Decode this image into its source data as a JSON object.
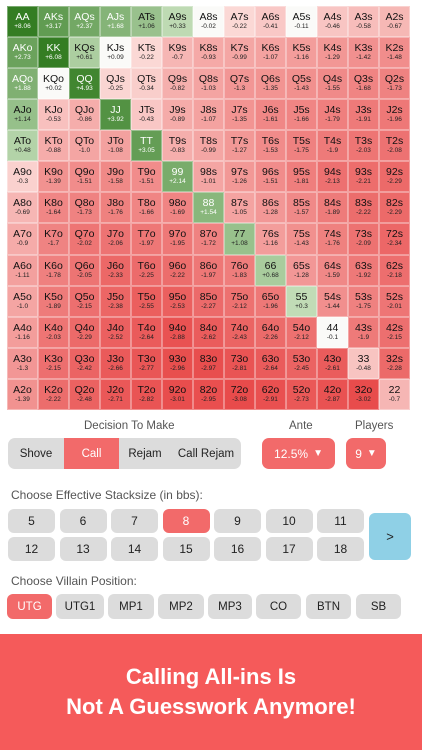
{
  "hand_grid": {
    "rows": [
      [
        [
          "AA",
          "+8.06"
        ],
        [
          "AKs",
          "+3.17"
        ],
        [
          "AQs",
          "+2.37"
        ],
        [
          "AJs",
          "+1.68"
        ],
        [
          "ATs",
          "+1.06"
        ],
        [
          "A9s",
          "+0.33"
        ],
        [
          "A8s",
          "-0.02"
        ],
        [
          "A7s",
          "-0.22"
        ],
        [
          "A6s",
          "-0.41"
        ],
        [
          "A5s",
          "-0.11"
        ],
        [
          "A4s",
          "-0.46"
        ],
        [
          "A3s",
          "-0.58"
        ],
        [
          "A2s",
          "-0.67"
        ]
      ],
      [
        [
          "AKo",
          "+2.73"
        ],
        [
          "KK",
          "+6.08"
        ],
        [
          "KQs",
          "+0.61"
        ],
        [
          "KJs",
          "+0.09"
        ],
        [
          "KTs",
          "-0.22"
        ],
        [
          "K9s",
          "-0.7"
        ],
        [
          "K8s",
          "-0.93"
        ],
        [
          "K7s",
          "-0.99"
        ],
        [
          "K6s",
          "-1.07"
        ],
        [
          "K5s",
          "-1.16"
        ],
        [
          "K4s",
          "-1.29"
        ],
        [
          "K3s",
          "-1.42"
        ],
        [
          "K2s",
          "-1.48"
        ]
      ],
      [
        [
          "AQo",
          "+1.88"
        ],
        [
          "KQo",
          "+0.02"
        ],
        [
          "QQ",
          "+4.93"
        ],
        [
          "QJs",
          "-0.25"
        ],
        [
          "QTs",
          "-0.34"
        ],
        [
          "Q9s",
          "-0.82"
        ],
        [
          "Q8s",
          "-1.03"
        ],
        [
          "Q7s",
          "-1.3"
        ],
        [
          "Q6s",
          "-1.35"
        ],
        [
          "Q5s",
          "-1.43"
        ],
        [
          "Q4s",
          "-1.55"
        ],
        [
          "Q3s",
          "-1.68"
        ],
        [
          "Q2s",
          "-1.73"
        ]
      ],
      [
        [
          "AJo",
          "+1.14"
        ],
        [
          "KJo",
          "-0.53"
        ],
        [
          "QJo",
          "-0.86"
        ],
        [
          "JJ",
          "+3.92"
        ],
        [
          "JTs",
          "-0.43"
        ],
        [
          "J9s",
          "-0.89"
        ],
        [
          "J8s",
          "-1.07"
        ],
        [
          "J7s",
          "-1.35"
        ],
        [
          "J6s",
          "-1.61"
        ],
        [
          "J5s",
          "-1.66"
        ],
        [
          "J4s",
          "-1.79"
        ],
        [
          "J3s",
          "-1.91"
        ],
        [
          "J2s",
          "-1.96"
        ]
      ],
      [
        [
          "ATo",
          "+0.48"
        ],
        [
          "KTo",
          "-0.88"
        ],
        [
          "QTo",
          "-1.0"
        ],
        [
          "JTo",
          "-1.08"
        ],
        [
          "TT",
          "+3.05"
        ],
        [
          "T9s",
          "-0.83"
        ],
        [
          "T8s",
          "-0.99"
        ],
        [
          "T7s",
          "-1.27"
        ],
        [
          "T6s",
          "-1.53"
        ],
        [
          "T5s",
          "-1.75"
        ],
        [
          "T4s",
          "-1.9"
        ],
        [
          "T3s",
          "-2.03"
        ],
        [
          "T2s",
          "-2.08"
        ]
      ],
      [
        [
          "A9o",
          "-0.3"
        ],
        [
          "K9o",
          "-1.39"
        ],
        [
          "Q9o",
          "-1.51"
        ],
        [
          "J9o",
          "-1.58"
        ],
        [
          "T9o",
          "-1.51"
        ],
        [
          "99",
          "+2.14"
        ],
        [
          "98s",
          "-1.01"
        ],
        [
          "97s",
          "-1.26"
        ],
        [
          "96s",
          "-1.51"
        ],
        [
          "95s",
          "-1.81"
        ],
        [
          "94s",
          "-2.13"
        ],
        [
          "93s",
          "-2.21"
        ],
        [
          "92s",
          "-2.29"
        ]
      ],
      [
        [
          "A8o",
          "-0.69"
        ],
        [
          "K8o",
          "-1.64"
        ],
        [
          "Q8o",
          "-1.73"
        ],
        [
          "J8o",
          "-1.76"
        ],
        [
          "T8o",
          "-1.66"
        ],
        [
          "98o",
          "-1.69"
        ],
        [
          "88",
          "+1.54"
        ],
        [
          "87s",
          "-1.05"
        ],
        [
          "86s",
          "-1.28"
        ],
        [
          "85s",
          "-1.57"
        ],
        [
          "84s",
          "-1.89"
        ],
        [
          "83s",
          "-2.22"
        ],
        [
          "82s",
          "-2.29"
        ]
      ],
      [
        [
          "A7o",
          "-0.9"
        ],
        [
          "K7o",
          "-1.7"
        ],
        [
          "Q7o",
          "-2.02"
        ],
        [
          "J7o",
          "-2.06"
        ],
        [
          "T7o",
          "-1.97"
        ],
        [
          "97o",
          "-1.95"
        ],
        [
          "87o",
          "-1.72"
        ],
        [
          "77",
          "+1.08"
        ],
        [
          "76s",
          "-1.16"
        ],
        [
          "75s",
          "-1.43"
        ],
        [
          "74s",
          "-1.76"
        ],
        [
          "73s",
          "-2.09"
        ],
        [
          "72s",
          "-2.34"
        ]
      ],
      [
        [
          "A6o",
          "-1.11"
        ],
        [
          "K6o",
          "-1.78"
        ],
        [
          "Q6o",
          "-2.05"
        ],
        [
          "J6o",
          "-2.33"
        ],
        [
          "T6o",
          "-2.25"
        ],
        [
          "96o",
          "-2.22"
        ],
        [
          "86o",
          "-1.97"
        ],
        [
          "76o",
          "-1.83"
        ],
        [
          "66",
          "+0.68"
        ],
        [
          "65s",
          "-1.28"
        ],
        [
          "64s",
          "-1.59"
        ],
        [
          "63s",
          "-1.92"
        ],
        [
          "62s",
          "-2.18"
        ]
      ],
      [
        [
          "A5o",
          "-1.0"
        ],
        [
          "K5o",
          "-1.89"
        ],
        [
          "Q5o",
          "-2.15"
        ],
        [
          "J5o",
          "-2.38"
        ],
        [
          "T5o",
          "-2.55"
        ],
        [
          "95o",
          "-2.53"
        ],
        [
          "85o",
          "-2.27"
        ],
        [
          "75o",
          "-2.12"
        ],
        [
          "65o",
          "-1.96"
        ],
        [
          "55",
          "+0.3"
        ],
        [
          "54s",
          "-1.44"
        ],
        [
          "53s",
          "-1.75"
        ],
        [
          "52s",
          "-2.01"
        ]
      ],
      [
        [
          "A4o",
          "-1.16"
        ],
        [
          "K4o",
          "-2.03"
        ],
        [
          "Q4o",
          "-2.29"
        ],
        [
          "J4o",
          "-2.52"
        ],
        [
          "T4o",
          "-2.64"
        ],
        [
          "94o",
          "-2.88"
        ],
        [
          "84o",
          "-2.62"
        ],
        [
          "74o",
          "-2.43"
        ],
        [
          "64o",
          "-2.26"
        ],
        [
          "54o",
          "-2.12"
        ],
        [
          "44",
          "-0.1"
        ],
        [
          "43s",
          "-1.9"
        ],
        [
          "42s",
          "-2.15"
        ]
      ],
      [
        [
          "A3o",
          "-1.3"
        ],
        [
          "K3o",
          "-2.15"
        ],
        [
          "Q3o",
          "-2.42"
        ],
        [
          "J3o",
          "-2.66"
        ],
        [
          "T3o",
          "-2.77"
        ],
        [
          "93o",
          "-2.96"
        ],
        [
          "83o",
          "-2.97"
        ],
        [
          "73o",
          "-2.81"
        ],
        [
          "63o",
          "-2.64"
        ],
        [
          "53o",
          "-2.45"
        ],
        [
          "43o",
          "-2.61"
        ],
        [
          "33",
          "-0.48"
        ],
        [
          "32s",
          "-2.28"
        ]
      ],
      [
        [
          "A2o",
          "-1.39"
        ],
        [
          "K2o",
          "-2.22"
        ],
        [
          "Q2o",
          "-2.48"
        ],
        [
          "J2o",
          "-2.71"
        ],
        [
          "T2o",
          "-2.82"
        ],
        [
          "92o",
          "-3.01"
        ],
        [
          "82o",
          "-2.95"
        ],
        [
          "72o",
          "-3.08"
        ],
        [
          "62o",
          "-2.91"
        ],
        [
          "52o",
          "-2.73"
        ],
        [
          "42o",
          "-2.87"
        ],
        [
          "32o",
          "-3.02"
        ],
        [
          "22",
          "-0.7"
        ]
      ]
    ]
  },
  "decision": {
    "label": "Decision To Make",
    "options": [
      "Shove",
      "Call",
      "Rejam",
      "Call Rejam"
    ],
    "selected_index": 1
  },
  "ante": {
    "label": "Ante",
    "value": "12.5%",
    "arrow": "▼"
  },
  "players": {
    "label": "Players",
    "value": "9",
    "arrow": "▼"
  },
  "stack": {
    "label": "Choose Effective Stacksize (in bbs):",
    "options": [
      "5",
      "6",
      "7",
      "8",
      "9",
      "10",
      "11",
      "12",
      "13",
      "14",
      "15",
      "16",
      "17",
      "18"
    ],
    "selected": "8",
    "next_label": ">"
  },
  "villain": {
    "label": "Choose Villain Position:",
    "options": [
      "UTG",
      "UTG1",
      "MP1",
      "MP2",
      "MP3",
      "CO",
      "BTN",
      "SB"
    ],
    "selected": "UTG"
  },
  "banner": {
    "line1": "Calling All-ins Is",
    "line2": "Not A Guesswork Anymore!"
  },
  "colors": {
    "accent": "#f26a6a",
    "banner": "#f55a5a",
    "positive_dark": "#2f7d1f",
    "positive_light": "#d8ecd0",
    "negative_strong": "#e84848",
    "neutral": "#ffffff",
    "next_button": "#8fd0e6",
    "button_gray": "#dcdcdc"
  },
  "icons": {
    "dropdown": "triangle-down-icon",
    "next": "chevron-right-icon"
  }
}
